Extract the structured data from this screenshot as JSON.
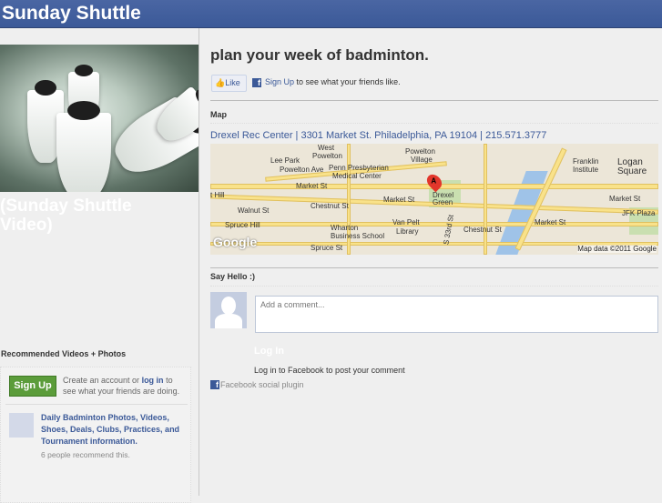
{
  "header": {
    "title": "Sunday Shuttle"
  },
  "left": {
    "video_caption": "(Sunday Shuttle Video)",
    "recommended": {
      "title": "Recommended Videos + Photos",
      "signup_label": "Sign Up",
      "create_pre": "Create an account or ",
      "login_link": "log in",
      "create_post": " to see what your friends are doing.",
      "item_title": "Daily Badminton Photos, Videos, Shoes, Deals, Clubs, Practices, and Tournament information.",
      "item_count": "6 people recommend this."
    }
  },
  "main": {
    "title": "plan your week of badminton.",
    "like_label": "Like",
    "signup_link": "Sign Up",
    "signup_text": " to see what your friends like.",
    "map_section": "Map",
    "address": "Drexel Rec Center | 3301 Market St. Philadelphia, PA 19104 | 215.571.3777",
    "map": {
      "labels": [
        "West",
        "Powelton",
        "Lee Park",
        "Powelton Ave",
        "Penn Presbyterian",
        "Medical Center",
        "Powelton",
        "Village",
        "Market St",
        "Market St",
        "Chestnut St",
        "Walnut St",
        "Spruce Hill",
        "Wharton",
        "Business School",
        "Van Pelt",
        "Library",
        "S 33rd St",
        "Chestnut St",
        "Market St",
        "Spruce St",
        "Franklin",
        "Institute",
        "Logan",
        "Square",
        "JFK Plaza",
        "Market St",
        "t Hill",
        "Drexel",
        "Green"
      ],
      "marker": "A",
      "logo": "Google",
      "attribution": "Map data ©2011 Google"
    },
    "comments": {
      "section": "Say Hello :)",
      "placeholder": "Add a comment...",
      "login_label": "Log In",
      "login_text": "Log in to Facebook to post your comment",
      "plugin": "Facebook social plugin"
    }
  }
}
